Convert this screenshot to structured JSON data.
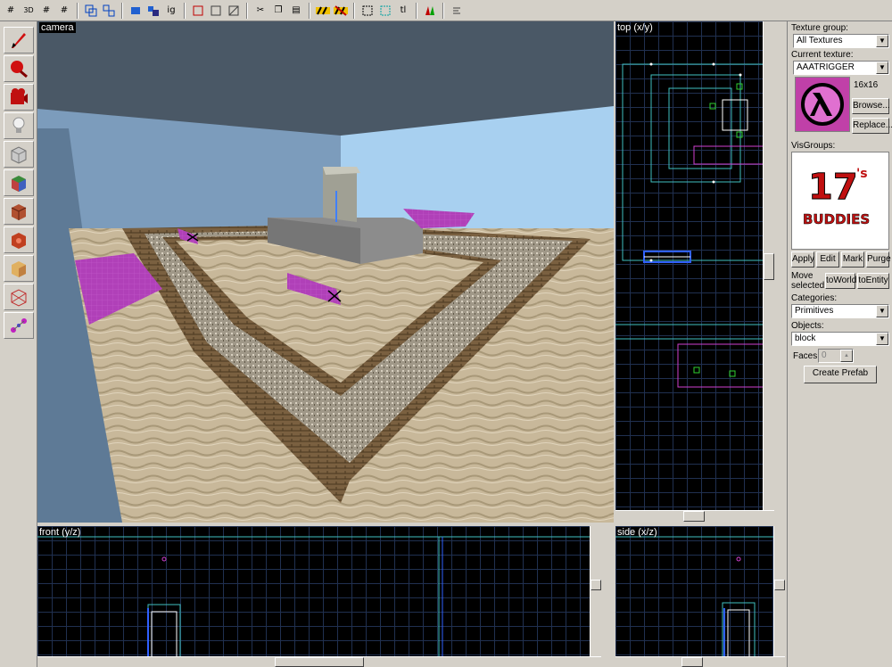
{
  "toolbar": {
    "buttons": [
      "grid-icon",
      "3d-grid-icon",
      "grid-smaller-icon",
      "grid-larger-icon",
      "group-icon",
      "ungroup-icon",
      "hide-icon",
      "texture-lock-icon",
      "ignore-groups-label",
      "carve-icon",
      "hollow-icon",
      "clip-icon",
      "cut-icon",
      "copy-icon",
      "paste-icon",
      "to-entity-icon",
      "to-world-icon",
      "select-icon",
      "texture-app-icon",
      "tl-label",
      "run-map-icon",
      "options-icon"
    ],
    "ig_label": "ig",
    "tl_label": "tl",
    "threed_label": "3D"
  },
  "tools": [
    "selection-tool",
    "magnify-tool",
    "camera-tool",
    "entity-tool",
    "block-tool",
    "texture-app-tool",
    "apply-texture-tool",
    "decal-tool",
    "overlay-tool",
    "clipping-tool",
    "vertex-tool",
    "path-tool"
  ],
  "views": {
    "camera": "camera",
    "top": "top (x/y)",
    "front": "front (y/z)",
    "side": "side (x/z)"
  },
  "panel": {
    "texture_group_label": "Texture group:",
    "texture_group_value": "All Textures",
    "current_texture_label": "Current texture:",
    "current_texture_value": "AAATRIGGER",
    "texture_size": "16x16",
    "browse_label": "Browse...",
    "replace_label": "Replace...",
    "visgroups_label": "VisGroups:",
    "visgroup_logo_number": "17",
    "visgroup_logo_suffix": "'s",
    "visgroup_logo_text": "BUDDIES",
    "apply_label": "Apply",
    "edit_label": "Edit",
    "mark_label": "Mark",
    "purge_label": "Purge",
    "move_selected_label": "Move selected:",
    "to_world_label": "toWorld",
    "to_entity_label": "toEntity",
    "categories_label": "Categories:",
    "categories_value": "Primitives",
    "objects_label": "Objects:",
    "objects_value": "block",
    "faces_label": "Faces:",
    "faces_value": "0",
    "create_prefab_label": "Create Prefab"
  }
}
